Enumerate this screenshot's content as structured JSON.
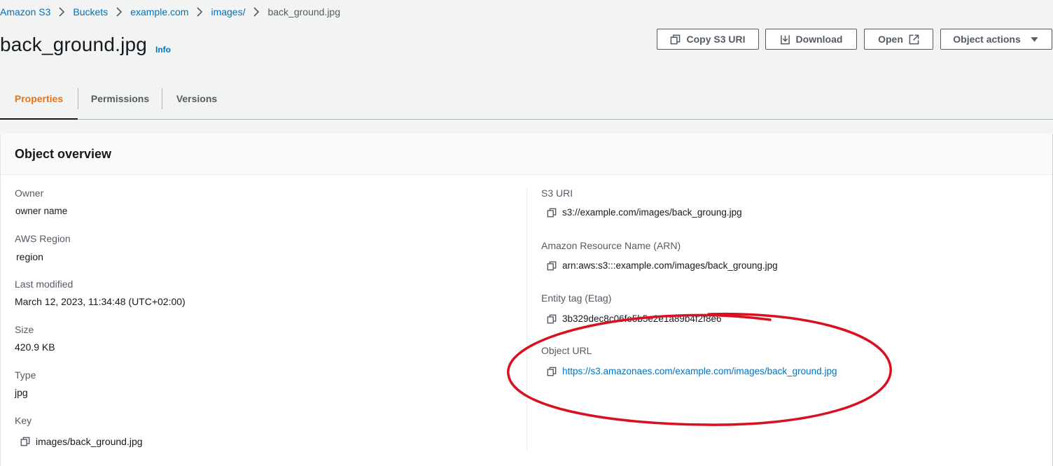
{
  "breadcrumb": {
    "items": [
      "Amazon S3",
      "Buckets",
      "example.com",
      "images/"
    ],
    "current": "back_ground.jpg"
  },
  "header": {
    "title": "back_ground.jpg",
    "info_label": "Info"
  },
  "actions": {
    "copy_uri": "Copy S3 URI",
    "download": "Download",
    "open": "Open",
    "object_actions": "Object actions"
  },
  "tabs": [
    "Properties",
    "Permissions",
    "Versions"
  ],
  "active_tab": "Properties",
  "overview": {
    "title": "Object overview",
    "left": [
      {
        "label": "Owner",
        "value": "owner name"
      },
      {
        "label": "AWS Region",
        "value": "region"
      },
      {
        "label": "Last modified",
        "value": "March 12, 2023, 11:34:48 (UTC+02:00)"
      },
      {
        "label": "Size",
        "value": "420.9 KB"
      },
      {
        "label": "Type",
        "value": "jpg"
      },
      {
        "label": "Key",
        "value": "images/back_ground.jpg"
      }
    ],
    "right": [
      {
        "label": "S3 URI",
        "value": "s3://example.com/images/back_groung.jpg"
      },
      {
        "label": "Amazon Resource Name (ARN)",
        "value": "arn:aws:s3:::example.com/images/back_groung.jpg"
      },
      {
        "label": "Entity tag (Etag)",
        "value": "3b329dec8c06fe5b5e2e1a89b4f2f8e6"
      },
      {
        "label": "Object URL",
        "value": "https://s3.amazonaes.com/example.com/images/back_ground.jpg"
      }
    ]
  },
  "icons": {
    "copy": "copy-icon",
    "download": "download-icon",
    "external": "external-link-icon",
    "caret": "caret-down-icon",
    "chevron": "chevron-right-icon"
  },
  "colors": {
    "link": "#0073bb",
    "active_tab": "#ec7211",
    "annotation": "#d9101f",
    "background": "#f2f3f3"
  }
}
